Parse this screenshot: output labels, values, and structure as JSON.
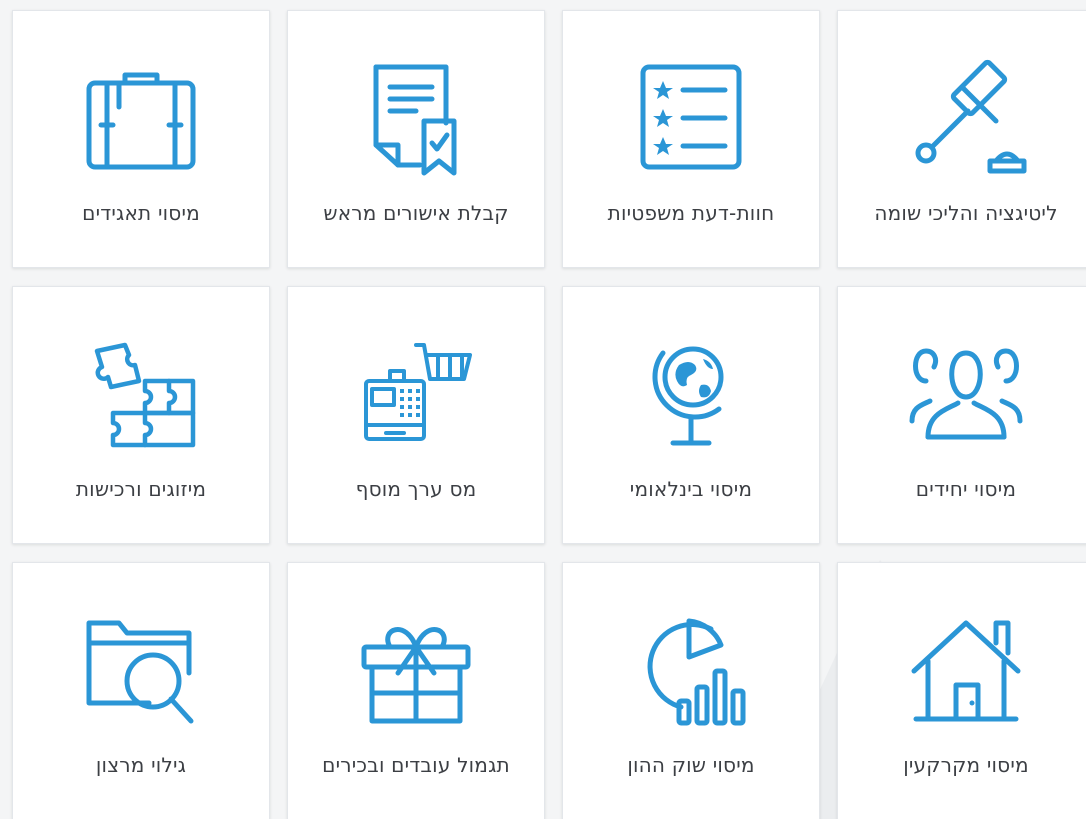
{
  "accent_color": "#2b96d6",
  "services": [
    {
      "label": "ליטיגציה והליכי שומה",
      "icon": "gavel-icon"
    },
    {
      "label": "חוות-דעת משפטיות",
      "icon": "star-list-icon"
    },
    {
      "label": "קבלת אישורים מראש",
      "icon": "approved-document-icon"
    },
    {
      "label": "מיסוי תאגידים",
      "icon": "briefcase-icon"
    },
    {
      "label": "מיסוי יחידים",
      "icon": "people-icon"
    },
    {
      "label": "מיסוי בינלאומי",
      "icon": "globe-icon"
    },
    {
      "label": "מס ערך מוסף",
      "icon": "cash-register-cart-icon"
    },
    {
      "label": "מיזוגים ורכישות",
      "icon": "puzzle-icon"
    },
    {
      "label": "מיסוי מקרקעין",
      "icon": "house-icon"
    },
    {
      "label": "מיסוי שוק ההון",
      "icon": "pie-bar-chart-icon"
    },
    {
      "label": "תגמול עובדים ובכירים",
      "icon": "gift-icon"
    },
    {
      "label": "גילוי מרצון",
      "icon": "folder-search-icon"
    }
  ]
}
